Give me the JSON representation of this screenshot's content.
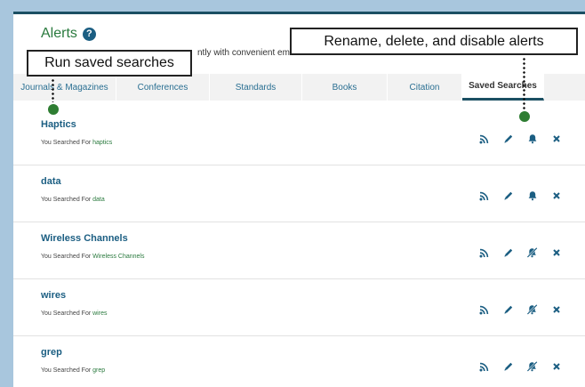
{
  "page": {
    "title": "Alerts",
    "intro_fragment": "ntly with convenient email"
  },
  "tabs": [
    {
      "label": "Journals & Magazines"
    },
    {
      "label": "Conferences"
    },
    {
      "label": "Standards"
    },
    {
      "label": "Books"
    },
    {
      "label": "Citation"
    },
    {
      "label": "Saved Searches",
      "active": true
    }
  ],
  "rows": [
    {
      "title": "Haptics",
      "prefix": "You Searched For",
      "term": "haptics",
      "alert_enabled": true
    },
    {
      "title": "data",
      "prefix": "You Searched For",
      "term": "data",
      "alert_enabled": true
    },
    {
      "title": "Wireless Channels",
      "prefix": "You Searched For",
      "term": "Wireless Channels",
      "alert_enabled": false
    },
    {
      "title": "wires",
      "prefix": "You Searched For",
      "term": "wires",
      "alert_enabled": false
    },
    {
      "title": "grep",
      "prefix": "You Searched For",
      "term": "grep",
      "alert_enabled": false
    }
  ],
  "callouts": {
    "run": "Run saved searches",
    "manage": "Rename, delete, and disable alerts"
  },
  "icons": {
    "help": "help-icon",
    "rss": "rss-icon",
    "edit": "pencil-icon",
    "alert_on": "bell-icon",
    "alert_off": "bell-off-icon",
    "delete": "close-icon"
  },
  "colors": {
    "title_green": "#2a7a3e",
    "link_blue": "#1b5e82",
    "callout_dot": "#2e7d32",
    "frame": "#1b4f63",
    "background": "#a8c6dd"
  }
}
